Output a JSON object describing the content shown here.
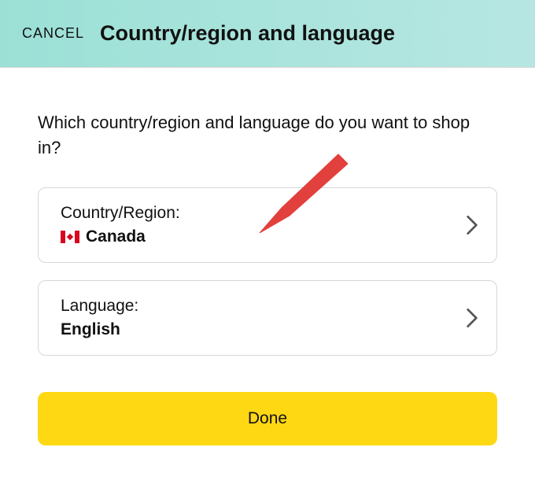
{
  "header": {
    "cancel_label": "CANCEL",
    "title": "Country/region and language"
  },
  "main": {
    "prompt": "Which country/region and language do you want to shop in?",
    "country_card": {
      "label": "Country/Region:",
      "value": "Canada",
      "flag": "canada-flag"
    },
    "language_card": {
      "label": "Language:",
      "value": "English"
    },
    "done_label": "Done"
  }
}
